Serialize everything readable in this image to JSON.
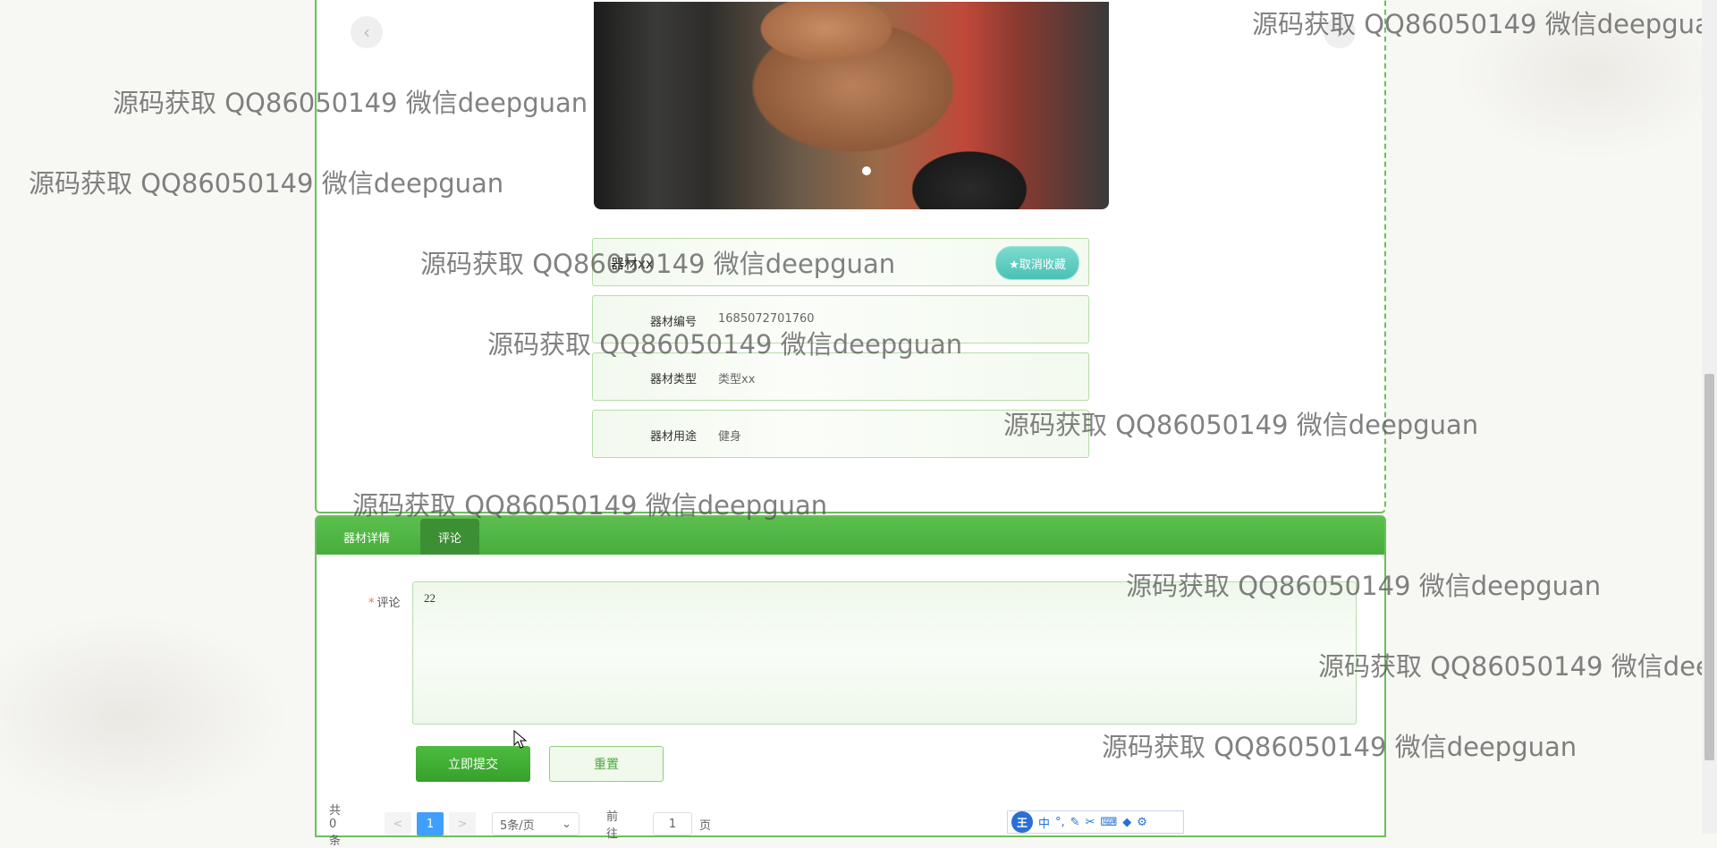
{
  "carousel": {
    "prev_icon": "‹",
    "next_icon": "›"
  },
  "equipment": {
    "name": "器材xx",
    "favorite_label": "★取消收藏",
    "fields": [
      {
        "label": "器材编号",
        "value": "1685072701760"
      },
      {
        "label": "器材类型",
        "value": "类型xx"
      },
      {
        "label": "器材用途",
        "value": "健身"
      }
    ]
  },
  "tabs": [
    {
      "label": "器材详情"
    },
    {
      "label": "评论"
    }
  ],
  "comment_form": {
    "required_mark": "*",
    "label": "评论",
    "value": "22",
    "submit_label": "立即提交",
    "reset_label": "重置"
  },
  "pagination": {
    "total": "共 0 条",
    "prev": "<",
    "current": "1",
    "next": ">",
    "page_size": "5条/页",
    "goto_prefix": "前往",
    "goto_value": "1",
    "goto_suffix": "页"
  },
  "ime_toolbar": {
    "logo": "王",
    "mode": "中"
  },
  "watermark": "源码获取 QQ86050149 微信deepguan"
}
